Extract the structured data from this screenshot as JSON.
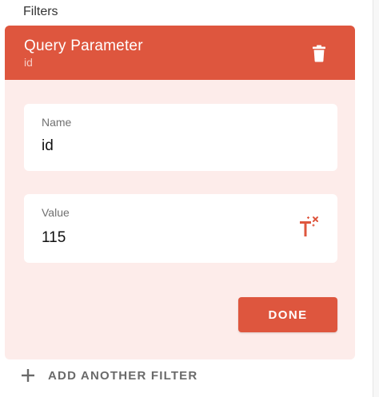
{
  "section": {
    "title": "Filters"
  },
  "filter": {
    "title": "Query Parameter",
    "subtitle": "id",
    "name_label": "Name",
    "name_value": "id",
    "value_label": "Value",
    "value_value": "115",
    "done_label": "DONE"
  },
  "add_filter": {
    "label": "ADD ANOTHER FILTER"
  },
  "icons": {
    "delete": "trash-icon",
    "template": "text-template-icon",
    "add": "plus-icon"
  },
  "colors": {
    "accent": "#de563e",
    "card_background": "#fdecea",
    "field_background": "#ffffff",
    "muted_text": "#6a6a6a"
  }
}
